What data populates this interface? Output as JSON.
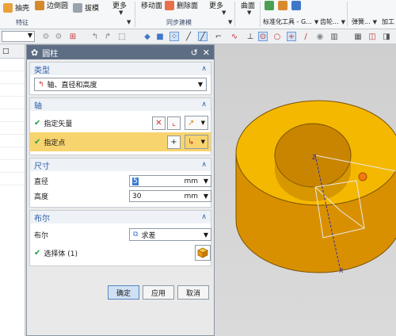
{
  "ribbon": {
    "shell_label": "抽壳",
    "edge_blend_label": "边倒圆",
    "draft_label": "拔模",
    "more1_label": "更多",
    "move_face_label": "移动面",
    "more2_label": "更多",
    "delete_face_label": "删除面",
    "more3_label": "更多",
    "surface_label": "曲面",
    "standard_parts_label": "标准化工具 - G...",
    "gear_label": "齿轮...",
    "spring_label": "弹簧...",
    "process_label": "加工",
    "group_feature": "特征",
    "group_sync": "同步建模"
  },
  "dialog": {
    "title": "圆柱",
    "type_section": {
      "header": "类型",
      "value": "轴、直径和高度"
    },
    "axis_section": {
      "header": "轴",
      "vector_label": "指定矢量",
      "point_label": "指定点"
    },
    "dimensions_section": {
      "header": "尺寸",
      "diameter_label": "直径",
      "diameter_value": "5",
      "diameter_unit": "mm",
      "height_label": "高度",
      "height_value": "30",
      "height_unit": "mm"
    },
    "boolean_section": {
      "header": "布尔",
      "boolean_label": "布尔",
      "boolean_value": "求差",
      "select_body_label": "选择体 (1)"
    },
    "buttons": {
      "ok": "确定",
      "apply": "应用",
      "cancel": "取消"
    }
  },
  "viewport": {
    "axis_label": "Z",
    "x_axis_label": "X"
  },
  "colors": {
    "part": "#f5b800",
    "title_bar": "#5d6e84",
    "highlight_row": "#f8d46e",
    "section_header_text": "#2a5ea8"
  }
}
